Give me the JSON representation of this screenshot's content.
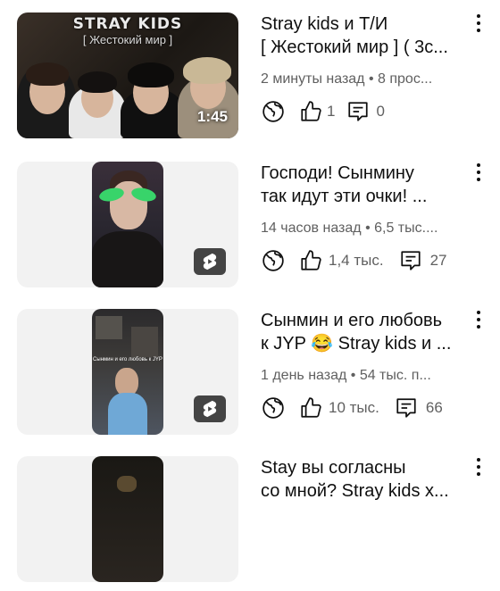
{
  "feed": [
    {
      "type": "video",
      "thumb_title": "STRAY KIDS",
      "thumb_subtitle": "[ Жестокий мир ]",
      "duration": "1:45",
      "title_line1": "Stray kids и Т/И",
      "title_line2": "[ Жестокий мир ] ( 3с...",
      "meta": "2 минуты назад • 8 прос...",
      "likes": "1",
      "comments": "0",
      "icons": [
        "globe-icon",
        "thumbs-up-icon",
        "comment-icon",
        "more-vert-icon"
      ]
    },
    {
      "type": "short",
      "title_line1": "Господи! Сынмину",
      "title_line2": "так идут эти очки! ...",
      "meta": "14 часов назад • 6,5 тыс....",
      "likes": "1,4 тыс.",
      "comments": "27",
      "icons": [
        "globe-icon",
        "thumbs-up-icon",
        "comment-icon",
        "shorts-icon",
        "more-vert-icon"
      ]
    },
    {
      "type": "short",
      "thumb_caption": "Сынмин и его любовь к JYP",
      "title_line1": "Сынмин и его любовь",
      "title_line2": "к JYP 😂 Stray kids и ...",
      "meta": "1 день назад • 54 тыс. п...",
      "likes": "10 тыс.",
      "comments": "66",
      "icons": [
        "globe-icon",
        "thumbs-up-icon",
        "comment-icon",
        "shorts-icon",
        "more-vert-icon"
      ]
    },
    {
      "type": "short",
      "title_line1": "Stay вы согласны",
      "title_line2": "со мной? Stray kids х..."
    }
  ],
  "colors": {
    "text_primary": "#0f0f0f",
    "text_secondary": "#606060",
    "thumb_bg": "#f2f2f2"
  }
}
